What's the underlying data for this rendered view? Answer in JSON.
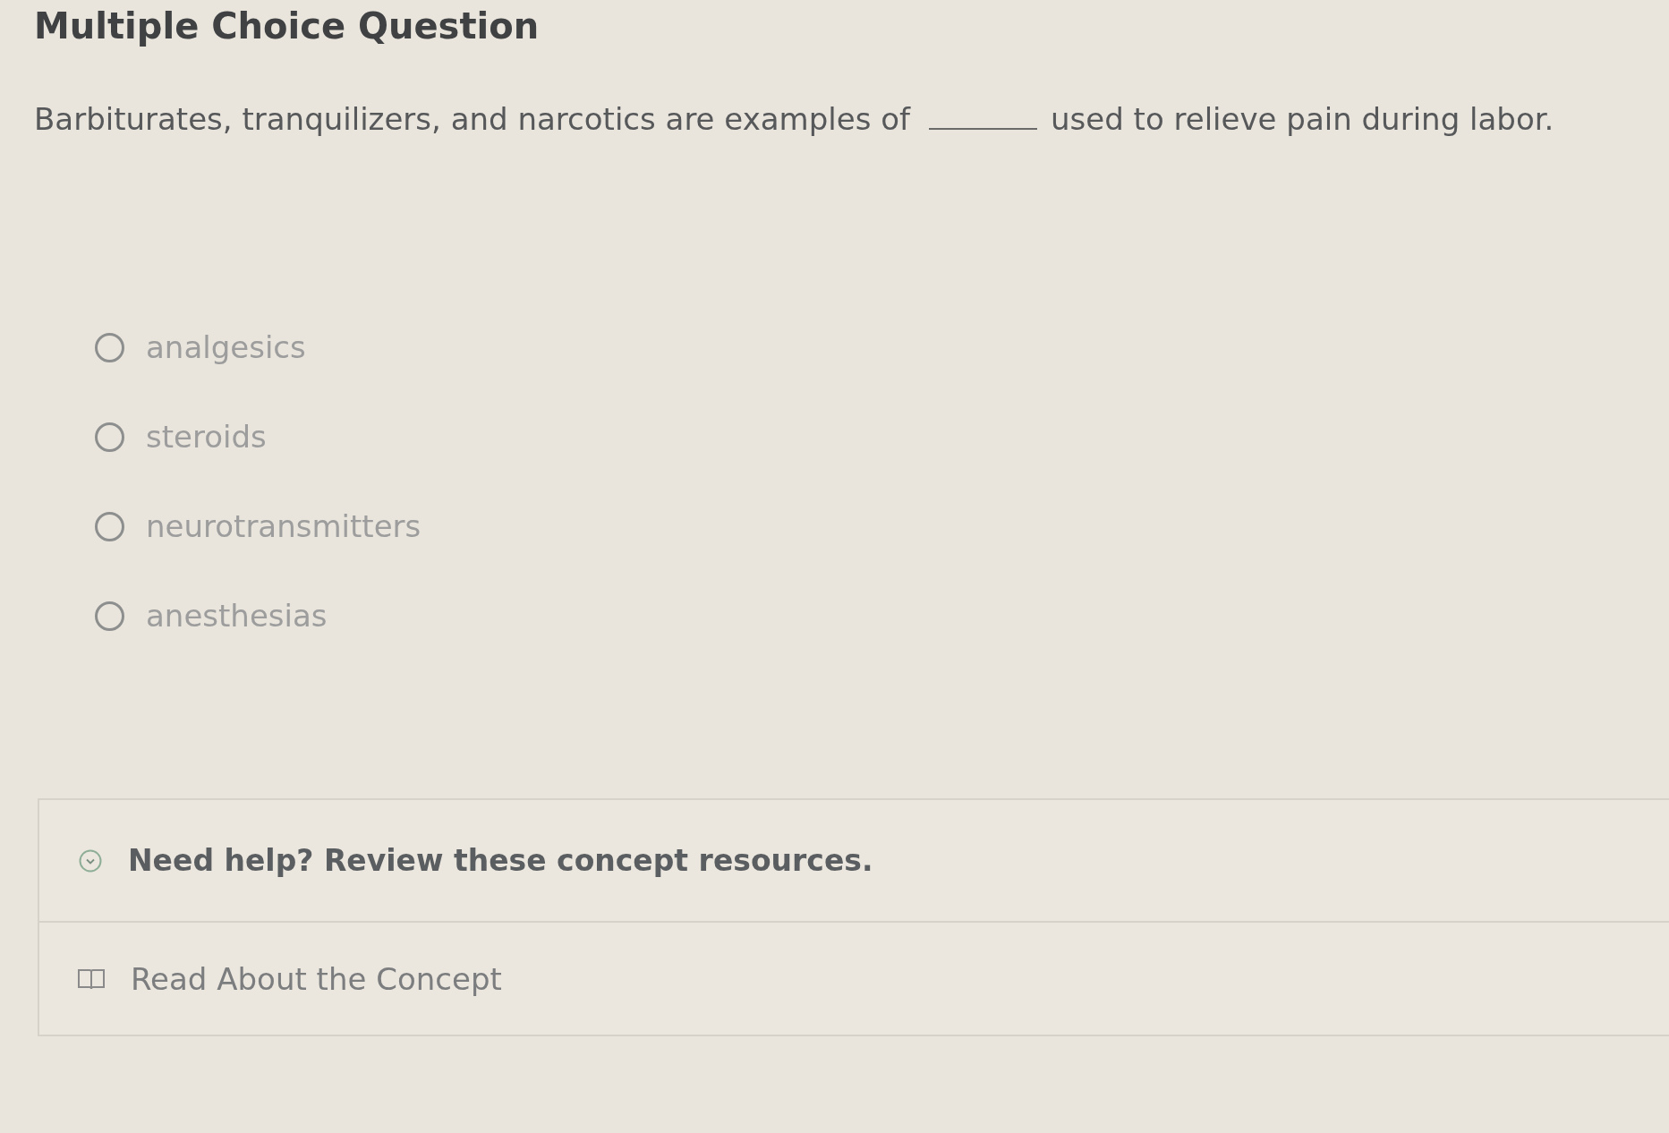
{
  "title": "Multiple Choice Question",
  "question": {
    "text_before": "Barbiturates, tranquilizers, and narcotics are examples of",
    "text_after": "used to relieve pain during labor."
  },
  "options": [
    {
      "label": "analgesics",
      "selected": false
    },
    {
      "label": "steroids",
      "selected": false
    },
    {
      "label": "neurotransmitters",
      "selected": false
    },
    {
      "label": "anesthesias",
      "selected": false
    }
  ],
  "help": {
    "heading": "Need help? Review these concept resources.",
    "resources": [
      {
        "label": "Read About the Concept"
      }
    ]
  }
}
